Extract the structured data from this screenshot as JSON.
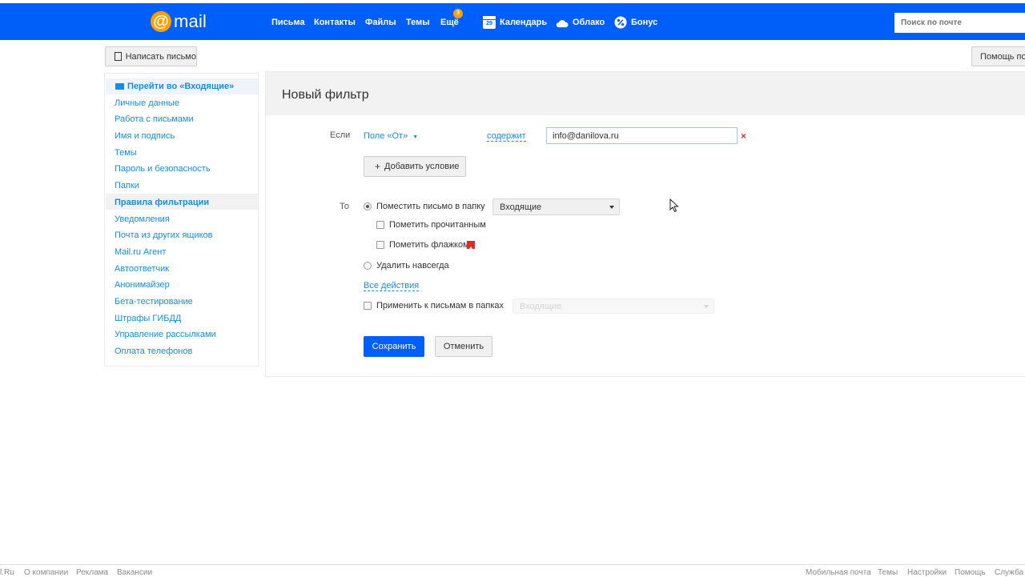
{
  "header": {
    "logo_text": "mail",
    "nav": [
      {
        "label": "Письма"
      },
      {
        "label": "Контакты"
      },
      {
        "label": "Файлы"
      },
      {
        "label": "Темы"
      },
      {
        "label": "Ещё"
      },
      {
        "label": "Календарь"
      },
      {
        "label": "Облако"
      },
      {
        "label": "Бонус"
      }
    ],
    "more_badge": "3",
    "calendar_day": "29",
    "search_placeholder": "Поиск по почте"
  },
  "toolbar": {
    "compose_label": "Написать письмо",
    "help_label": "Помощь по р"
  },
  "sidebar": {
    "goto_inbox": "Перейти во «Входящие»",
    "items": [
      "Личные данные",
      "Работа с письмами",
      "Имя и подпись",
      "Темы",
      "Пароль и безопасность",
      "Папки",
      "Правила фильтрации",
      "Уведомления",
      "Почта из других ящиков",
      "Mail.ru Агент",
      "Автоответчик",
      "Анонимайзер",
      "Бета-тестирование",
      "Штрафы ГИБДД",
      "Управление рассылками",
      "Оплата телефонов"
    ],
    "active_item": "Правила фильтрации"
  },
  "filter": {
    "title": "Новый фильтр",
    "if_label": "Если",
    "field_select": "Поле «От»",
    "operator": "содержит",
    "value": "info@danilova.ru",
    "add_condition": "Добавить условие",
    "then_label": "То",
    "move_to_folder": "Поместить письмо в папку",
    "folder_selected": "Входящие",
    "mark_read": "Пометить прочитанным",
    "mark_flag": "Пометить флажком",
    "delete_forever": "Удалить навсегда",
    "all_actions": "Все действия",
    "apply_to_folders": "Применить к письмам в папках",
    "apply_folder_selected": "Входящие",
    "save": "Сохранить",
    "cancel": "Отменить"
  },
  "footer": {
    "left": [
      "l.Ru",
      "О компании",
      "Реклама",
      "Вакансии"
    ],
    "right": [
      "Мобильная почта",
      "Темы",
      "Настройки",
      "Помощь",
      "Служба"
    ]
  },
  "colors": {
    "brand_blue": "#005ff9",
    "accent_orange": "#ff9e00",
    "link_blue": "#168de2",
    "delete_red": "#e23131",
    "flag_red": "#e3281f"
  }
}
